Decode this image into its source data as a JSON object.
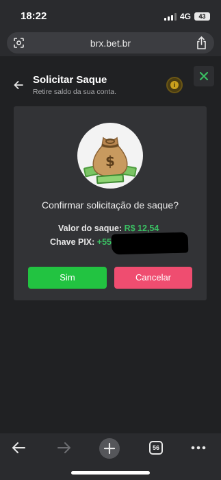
{
  "status_bar": {
    "time": "18:22",
    "network": "4G",
    "battery": "43"
  },
  "browser": {
    "url": "brx.bet.br",
    "tab_count": "56"
  },
  "header": {
    "title": "Solicitar Saque",
    "subtitle": "Retire saldo da sua conta.",
    "info_icon_label": "i"
  },
  "dialog": {
    "question": "Confirmar solicitação de saque?",
    "amount_label": "Valor do saque:",
    "amount_value": "R$ 12,54",
    "pix_label": "Chave PIX:",
    "pix_value": "+55",
    "confirm_button": "Sim",
    "cancel_button": "Cancelar"
  },
  "colors": {
    "accent_green": "#3ac163",
    "confirm_green": "#22c341",
    "cancel_pink": "#ef4d70",
    "card_bg": "#323336",
    "page_bg": "#202123"
  },
  "icons": {
    "close": "close-icon",
    "back": "back-arrow-icon",
    "info": "info-icon",
    "money_bag": "money-bag-icon",
    "share": "share-icon",
    "nav_back": "nav-back-icon",
    "nav_forward": "nav-forward-icon",
    "new_tab": "plus-icon",
    "tabs": "tabs-icon",
    "more": "more-icon"
  }
}
